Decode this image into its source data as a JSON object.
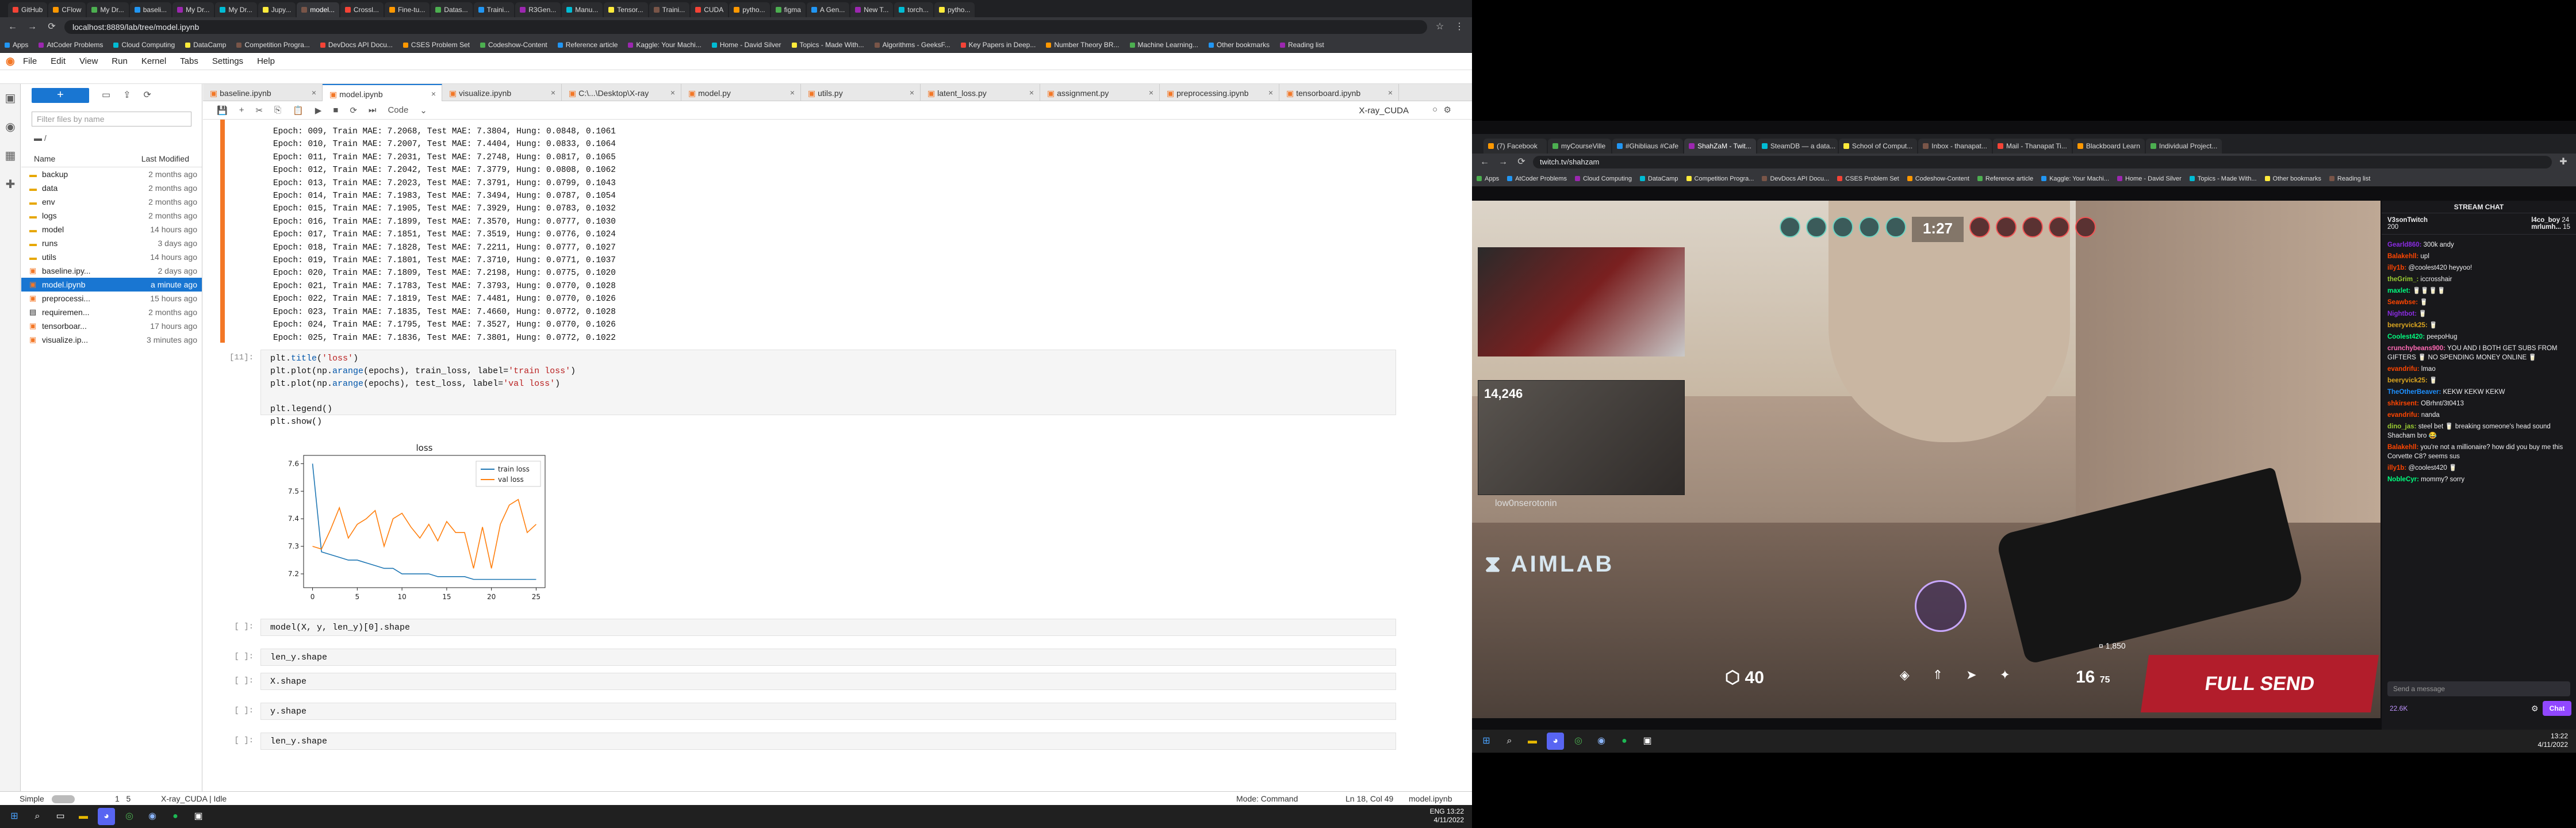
{
  "left": {
    "chrome_tabs": [
      "GitHub",
      "CFlow",
      "My Dr...",
      "baseli...",
      "My Dr...",
      "My Dr...",
      "Jupy...",
      "model...",
      "Crossl...",
      "Fine-tu...",
      "Datas...",
      "Traini...",
      "R3Gen...",
      "Manu...",
      "Tensor...",
      "Traini...",
      "CUDA",
      "pytho...",
      "figma",
      "A Gen...",
      "New T...",
      "torch...",
      "pytho..."
    ],
    "address": "localhost:8889/lab/tree/model.ipynb",
    "bookmarks": [
      "Apps",
      "AtCoder Problems",
      "Cloud Computing",
      "DataCamp",
      "Competition Progra...",
      "DevDocs API Docu...",
      "CSES Problem Set",
      "Codeshow-Content",
      "Reference article",
      "Kaggle: Your Machi...",
      "Home - David Silver",
      "Topics - Made With...",
      "Algorithms - GeeksF...",
      "Key Papers in Deep...",
      "Number Theory BR...",
      "Machine Learning...",
      "Other bookmarks",
      "Reading list"
    ],
    "menu": [
      "File",
      "Edit",
      "View",
      "Run",
      "Kernel",
      "Tabs",
      "Settings",
      "Help"
    ],
    "filter_placeholder": "Filter files by name",
    "crumb": "/",
    "col_name": "Name",
    "col_modified": "Last Modified",
    "files": [
      {
        "name": "backup",
        "mod": "2 months ago",
        "kind": "folder"
      },
      {
        "name": "data",
        "mod": "2 months ago",
        "kind": "folder"
      },
      {
        "name": "env",
        "mod": "2 months ago",
        "kind": "folder"
      },
      {
        "name": "logs",
        "mod": "2 months ago",
        "kind": "folder"
      },
      {
        "name": "model",
        "mod": "14 hours ago",
        "kind": "folder"
      },
      {
        "name": "runs",
        "mod": "3 days ago",
        "kind": "folder"
      },
      {
        "name": "utils",
        "mod": "14 hours ago",
        "kind": "folder"
      },
      {
        "name": "baseline.ipy...",
        "mod": "2 days ago",
        "kind": "nb"
      },
      {
        "name": "model.ipynb",
        "mod": "a minute ago",
        "kind": "nb"
      },
      {
        "name": "preprocessi...",
        "mod": "15 hours ago",
        "kind": "nb"
      },
      {
        "name": "requiremen...",
        "mod": "2 months ago",
        "kind": "file"
      },
      {
        "name": "tensorboar...",
        "mod": "17 hours ago",
        "kind": "nb"
      },
      {
        "name": "visualize.ip...",
        "mod": "3 minutes ago",
        "kind": "nb"
      }
    ],
    "nb_tabs": [
      "baseline.ipynb",
      "model.ipynb",
      "visualize.ipynb",
      "C:\\...\\Desktop\\X-ray",
      "model.py",
      "utils.py",
      "latent_loss.py",
      "assignment.py",
      "preprocessing.ipynb",
      "tensorboard.ipynb"
    ],
    "toolbar_mode": "Code",
    "kernel": "X-ray_CUDA",
    "output_lines": [
      "Epoch: 009, Train MAE: 7.2068, Test MAE: 7.3804, Hung: 0.0848, 0.1061",
      "Epoch: 010, Train MAE: 7.2007, Test MAE: 7.4404, Hung: 0.0833, 0.1064",
      "Epoch: 011, Train MAE: 7.2031, Test MAE: 7.2748, Hung: 0.0817, 0.1065",
      "Epoch: 012, Train MAE: 7.2042, Test MAE: 7.3779, Hung: 0.0808, 0.1062",
      "Epoch: 013, Train MAE: 7.2023, Test MAE: 7.3791, Hung: 0.0799, 0.1043",
      "Epoch: 014, Train MAE: 7.1983, Test MAE: 7.3494, Hung: 0.0787, 0.1054",
      "Epoch: 015, Train MAE: 7.1905, Test MAE: 7.3929, Hung: 0.0783, 0.1032",
      "Epoch: 016, Train MAE: 7.1899, Test MAE: 7.3570, Hung: 0.0777, 0.1030",
      "Epoch: 017, Train MAE: 7.1851, Test MAE: 7.3519, Hung: 0.0776, 0.1024",
      "Epoch: 018, Train MAE: 7.1828, Test MAE: 7.2211, Hung: 0.0777, 0.1027",
      "Epoch: 019, Train MAE: 7.1801, Test MAE: 7.3710, Hung: 0.0771, 0.1037",
      "Epoch: 020, Train MAE: 7.1809, Test MAE: 7.2198, Hung: 0.0775, 0.1020",
      "Epoch: 021, Train MAE: 7.1783, Test MAE: 7.3793, Hung: 0.0770, 0.1028",
      "Epoch: 022, Train MAE: 7.1819, Test MAE: 7.4481, Hung: 0.0770, 0.1026",
      "Epoch: 023, Train MAE: 7.1835, Test MAE: 7.4660, Hung: 0.0772, 0.1028",
      "Epoch: 024, Train MAE: 7.1795, Test MAE: 7.3527, Hung: 0.0770, 0.1026",
      "Epoch: 025, Train MAE: 7.1836, Test MAE: 7.3801, Hung: 0.0772, 0.1022"
    ],
    "cell11_prompt": "[11]:",
    "empty_prompt": "[ ]:",
    "cells_after": [
      "model(X, y, len_y)[0].shape",
      "len_y.shape",
      "X.shape",
      "y.shape",
      "len_y.shape"
    ],
    "status_left": "Simple",
    "status_nums": "1   5",
    "status_kernel": "X-ray_CUDA | Idle",
    "status_mode": "Mode: Command",
    "status_pos": "Ln 18, Col 49",
    "status_file": "model.ipynb",
    "clock_time": "13:22",
    "clock_date": "4/11/2022",
    "tray_lang": "ENG"
  },
  "chart_data": {
    "type": "line",
    "title": "loss",
    "x": [
      0,
      1,
      2,
      3,
      4,
      5,
      6,
      7,
      8,
      9,
      10,
      11,
      12,
      13,
      14,
      15,
      16,
      17,
      18,
      19,
      20,
      21,
      22,
      23,
      24,
      25
    ],
    "series": [
      {
        "name": "train loss",
        "color": "#1f77b4",
        "values": [
          7.6,
          7.28,
          7.27,
          7.26,
          7.25,
          7.25,
          7.24,
          7.23,
          7.22,
          7.22,
          7.2,
          7.2,
          7.2,
          7.2,
          7.19,
          7.19,
          7.19,
          7.19,
          7.18,
          7.18,
          7.18,
          7.18,
          7.18,
          7.18,
          7.18,
          7.18
        ]
      },
      {
        "name": "val loss",
        "color": "#ff7f0e",
        "values": [
          7.3,
          7.29,
          7.36,
          7.44,
          7.33,
          7.38,
          7.4,
          7.43,
          7.3,
          7.4,
          7.42,
          7.37,
          7.33,
          7.38,
          7.32,
          7.39,
          7.35,
          7.35,
          7.22,
          7.37,
          7.22,
          7.38,
          7.45,
          7.47,
          7.35,
          7.38
        ]
      }
    ],
    "xticks": [
      "0",
      "5",
      "10",
      "15",
      "20",
      "25"
    ],
    "yticks": [
      "7.2",
      "7.3",
      "7.4",
      "7.5",
      "7.6"
    ],
    "ylim": [
      7.15,
      7.63
    ],
    "xlim": [
      -1,
      26
    ],
    "legend": "top-right"
  },
  "right": {
    "tabs": [
      "(7) Facebook",
      "myCourseVille",
      "#Ghibliaus #Cafe",
      "ShahZaM - Twit...",
      "SteamDB — a data...",
      "School of Comput...",
      "Inbox - thanapat...",
      "Mail - Thanapat Ti...",
      "Blackboard Learn",
      "Individual Project..."
    ],
    "address": "twitch.tv/shahzam",
    "bookmarks": [
      "Apps",
      "AtCoder Problems",
      "Cloud Computing",
      "DataCamp",
      "Competition Progra...",
      "DevDocs API Docu...",
      "CSES Problem Set",
      "Codeshow-Content",
      "Reference article",
      "Kaggle: Your Machi...",
      "Home - David Silver",
      "Topics - Made With...",
      "Other bookmarks",
      "Reading list"
    ],
    "game_timer": "1:27",
    "cam_score": "14,246",
    "streamer_name": "low0nserotonin",
    "aim_logo": "AIMLAB",
    "hp": "40",
    "ammo": "16",
    "ammo_reserve": "75",
    "banner": "FULL SEND",
    "credits": "1,850",
    "chat_title": "STREAM CHAT",
    "top_chatter": "V3sonTwitch",
    "top_count": "200",
    "side_users": [
      "l4co_boy",
      "mrlumh..."
    ],
    "side_counts": [
      "24",
      "15"
    ],
    "messages": [
      {
        "user": "Gearld860:",
        "color": "#8a2be2",
        "text": "300k andy"
      },
      {
        "user": "Balakehll:",
        "color": "#ff4500",
        "text": "upl"
      },
      {
        "user": "illy1b:",
        "color": "#ff4500",
        "text": "@coolest420 heyyoo!"
      },
      {
        "user": "theGrim_:",
        "color": "#9acd32",
        "text": "iccrosshair"
      },
      {
        "user": "maxlet:",
        "color": "#00ff7f",
        "text": "🥛🥛🥛🥛"
      },
      {
        "user": "Seawbse:",
        "color": "#ff4500",
        "text": "🥛"
      },
      {
        "user": "Nightbot:",
        "color": "#8a2be2",
        "text": "🥛"
      },
      {
        "user": "beeryvick25:",
        "color": "#daa520",
        "text": "🥛"
      },
      {
        "user": "Coolest420:",
        "color": "#00ff7f",
        "text": "peepoHug"
      },
      {
        "user": "crunchybeans900:",
        "color": "#ff69b4",
        "text": "YOU AND I BOTH GET SUBS FROM GIFTERS 🥛 NO SPENDING MONEY ONLINE 🥛"
      },
      {
        "user": "evandrifu:",
        "color": "#ff4500",
        "text": "lmao"
      },
      {
        "user": "beeryvick25:",
        "color": "#daa520",
        "text": "🥛"
      },
      {
        "user": "TheOtherBeaver:",
        "color": "#1e90ff",
        "text": "KEKW KEKW KEKW"
      },
      {
        "user": "shkirsent:",
        "color": "#ff4500",
        "text": "OBrhnt/3t0413"
      },
      {
        "user": "evandrifu:",
        "color": "#ff4500",
        "text": "nanda"
      },
      {
        "user": "dino_jas:",
        "color": "#9acd32",
        "text": "steel bet 🥛 breaking someone's head sound Shacham bro 😂"
      },
      {
        "user": "Balakehll:",
        "color": "#ff4500",
        "text": "you're not a millionaire? how did you buy me this Corvette C8? seems sus"
      },
      {
        "user": "illy1b:",
        "color": "#ff4500",
        "text": "@coolest420 🥛"
      },
      {
        "user": "NobleCyr:",
        "color": "#00ff7f",
        "text": "mommy? sorry"
      }
    ],
    "chat_placeholder": "Send a message",
    "points": "22.6K",
    "chat_button": "Chat",
    "clock_time": "13:22",
    "clock_date": "4/11/2022"
  }
}
